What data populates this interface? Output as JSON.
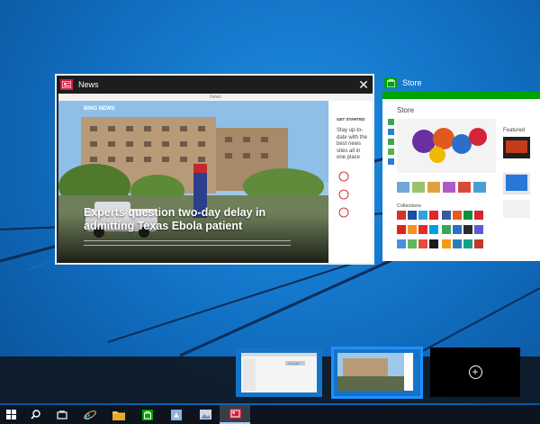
{
  "task_view": {
    "windows": [
      {
        "app": "News",
        "close_glyph": "✕",
        "icon": "news-icon",
        "accent": "#d01f41",
        "inner_title": "News",
        "brand": "BING NEWS",
        "article_headline": "Experts question two-day delay in admitting Texas Ebola patient",
        "side_heading": "GET STARTED",
        "side_text": "Stay up-to-date with the best news sites all in one place"
      },
      {
        "app": "Store",
        "icon": "store-icon",
        "accent": "#00a300",
        "page_title": "Store",
        "featured_label": "Featured",
        "collections_label": "Collections"
      }
    ],
    "desktops": {
      "new_desktop_glyph": "+"
    }
  },
  "taskbar": {
    "items": [
      {
        "name": "start-button",
        "icon": "windows-logo-icon"
      },
      {
        "name": "search-button",
        "icon": "search-icon"
      },
      {
        "name": "task-view-button",
        "icon": "task-view-icon"
      },
      {
        "name": "internet-explorer-button",
        "icon": "internet-explorer-icon"
      },
      {
        "name": "file-explorer-button",
        "icon": "folder-icon"
      },
      {
        "name": "store-button",
        "icon": "store-icon"
      },
      {
        "name": "app-button-1",
        "icon": "app-tile-icon"
      },
      {
        "name": "app-button-2",
        "icon": "photos-icon"
      },
      {
        "name": "news-button",
        "icon": "news-icon",
        "active": true
      }
    ]
  },
  "colors": {
    "desktop_blue": "#1272c6",
    "taskbar": "#0d1420",
    "highlight": "#1e90ff"
  }
}
